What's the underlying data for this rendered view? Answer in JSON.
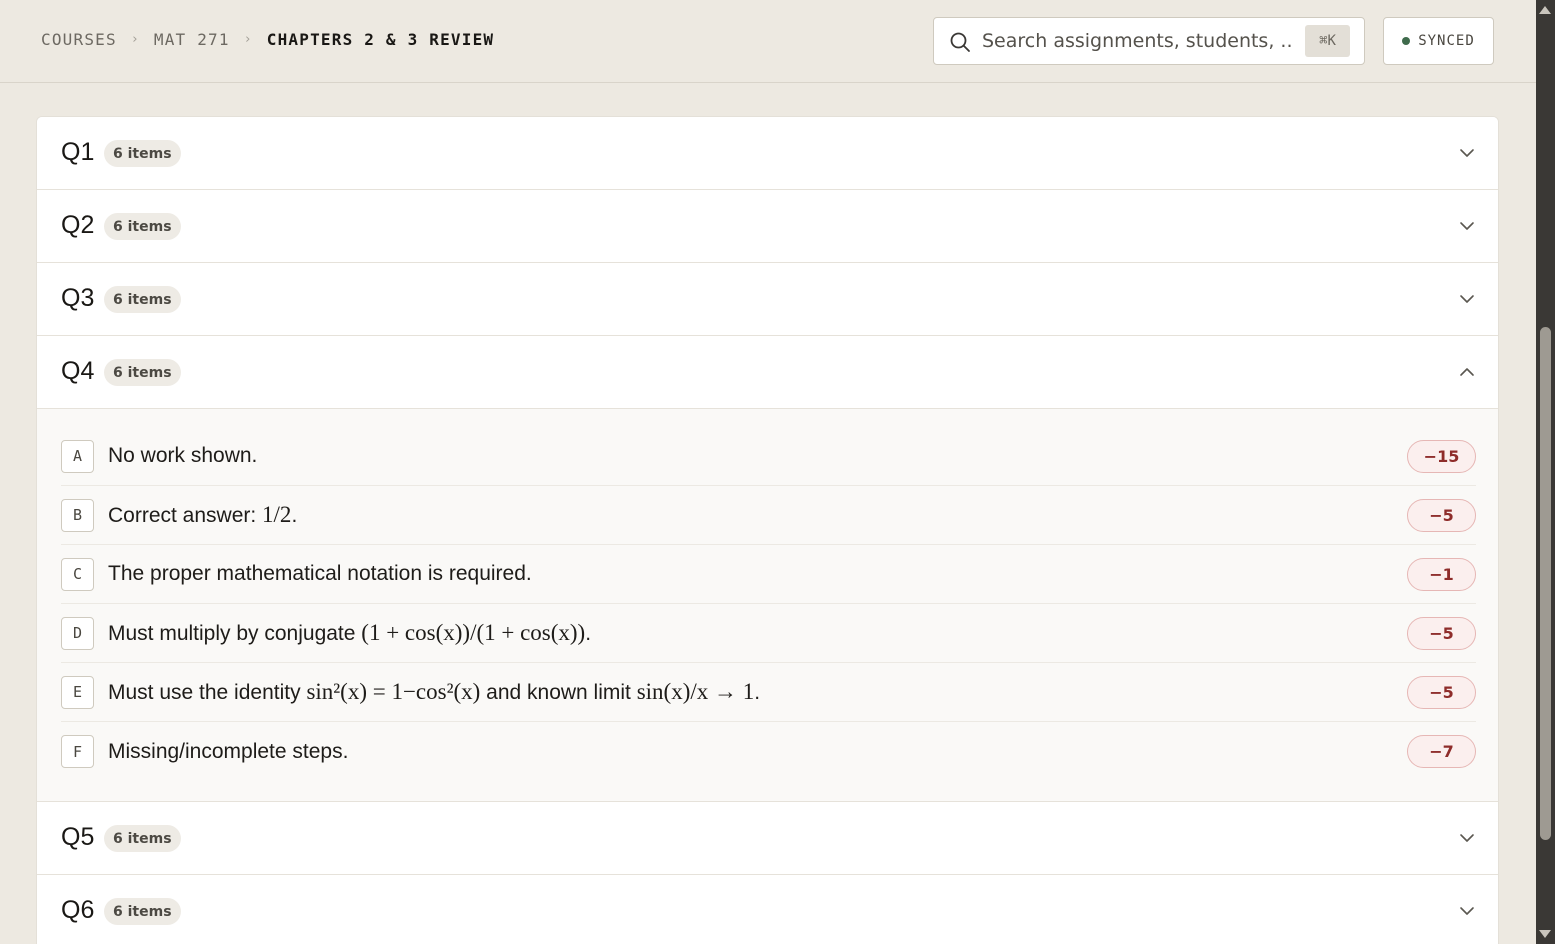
{
  "breadcrumb": {
    "items": [
      "COURSES",
      "MAT 271",
      "CHAPTERS 2 & 3 REVIEW"
    ],
    "separator": "›"
  },
  "search": {
    "placeholder": "Search assignments, students, ...",
    "shortcut": "⌘K"
  },
  "sync_status": {
    "label": "SYNCED",
    "color": "#3f6b4c"
  },
  "questions": [
    {
      "label": "Q1",
      "badge": "6 items",
      "expanded": false
    },
    {
      "label": "Q2",
      "badge": "6 items",
      "expanded": false
    },
    {
      "label": "Q3",
      "badge": "6 items",
      "expanded": false
    },
    {
      "label": "Q4",
      "badge": "6 items",
      "expanded": true,
      "items": [
        {
          "letter": "A",
          "text": "No work shown.",
          "points": "−15"
        },
        {
          "letter": "B",
          "text": "Correct answer: ",
          "math": "1/2",
          "suffix": ".",
          "points": "−5"
        },
        {
          "letter": "C",
          "text": "The proper mathematical notation is required.",
          "points": "−1"
        },
        {
          "letter": "D",
          "text": "Must multiply by conjugate ",
          "math": "(1 + cos(x))/(1 + cos(x))",
          "suffix": ".",
          "points": "−5"
        },
        {
          "letter": "E",
          "text": "Must use the identity ",
          "math": "sin²(x) = 1−cos²(x)",
          "text2": " and known limit ",
          "math2": "sin(x)/x → 1",
          "suffix": ".",
          "points": "−5"
        },
        {
          "letter": "F",
          "text": "Missing/incomplete steps.",
          "points": "−7"
        }
      ]
    },
    {
      "label": "Q5",
      "badge": "6 items",
      "expanded": false
    },
    {
      "label": "Q6",
      "badge": "6 items",
      "expanded": false
    }
  ],
  "icons": {
    "search": "search-icon",
    "collapsed": "chevron-down-icon",
    "expanded": "chevron-up-icon"
  },
  "colors": {
    "background": "#ede9e1",
    "deduction_text": "#8e2c2a",
    "deduction_bg": "#fbefee",
    "deduction_border": "#e6b7b5"
  }
}
